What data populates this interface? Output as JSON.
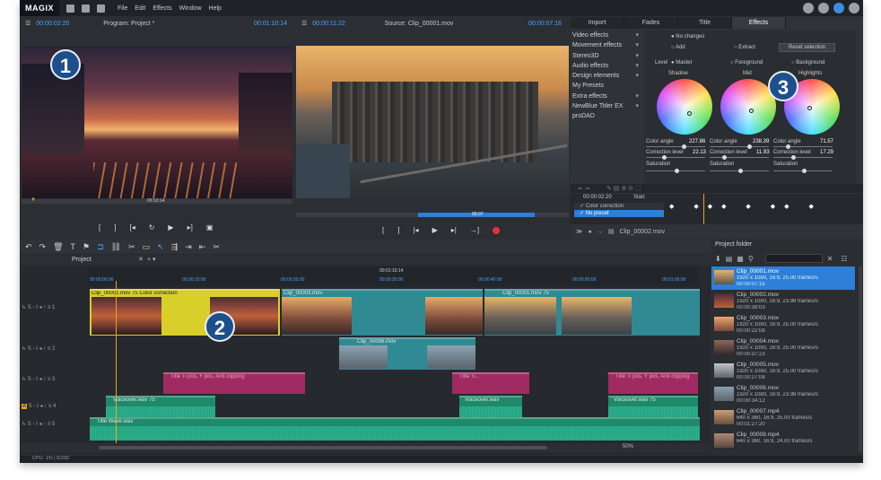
{
  "app": {
    "logo": "MAGIX",
    "menu": [
      "File",
      "Edit",
      "Effects",
      "Window",
      "Help"
    ]
  },
  "program_monitor": {
    "tc_left": "00:00:02:20",
    "title": "Program: Project *",
    "tc_right": "00:01:10:14",
    "scrub_tc": "00:10:14"
  },
  "source_monitor": {
    "tc_left": "00:00:11:22",
    "title": "Source: Clip_00001.mov",
    "tc_right": "00:00:07:16",
    "scrub_tc": "00:07"
  },
  "effects_panel": {
    "tabs": [
      "Import",
      "Fades",
      "Title",
      "Effects"
    ],
    "active_tab": "Effects",
    "categories": [
      "Video effects",
      "Movement effects",
      "Stereo3D",
      "Audio effects",
      "Design elements",
      "My Presets",
      "Extra effects",
      "NewBlue Titler EX",
      "proDAD"
    ],
    "no_changes": "No changes",
    "add": "Add",
    "extract": "Extract",
    "reset": "Reset selection",
    "level_label": "Level",
    "levels": [
      "Master",
      "Foreground",
      "Background"
    ],
    "wheels": [
      {
        "name": "Shadow",
        "color_angle": "227.86",
        "correction_level": "22.13"
      },
      {
        "name": "Mid",
        "color_angle": "238.39",
        "correction_level": "11.93"
      },
      {
        "name": "Highlights",
        "color_angle": "71.57",
        "correction_level": "17.29"
      }
    ],
    "color_angle_label": "Color angle",
    "correction_level_label": "Correction level",
    "saturation_label": "Saturation",
    "kf_time": "00:00:02:20",
    "kf_state": "Stati:",
    "kf_rows": [
      "Color correction",
      "No preset"
    ],
    "clip_name": "Clip_00002.mov"
  },
  "timeline": {
    "tab": "Project",
    "playhead": "00:01:10:14",
    "ruler": [
      "00:00:00:00",
      "00:00:10:00",
      "00:00:20:00",
      "00:00:30:00",
      "00:00:40:00",
      "00:00:50:00",
      "00:01:00:00"
    ],
    "clips": {
      "v1_a": "Clip_00002.mov  75  Color correction",
      "v1_b": "Clip_00003.mov",
      "v1_c": "Clip_00001.mov  75",
      "v2": "Clip_00006.mov",
      "t1": "Title  Ti pos, Y pos, Anti clipping",
      "t2": "Title  Ti...",
      "t3": "Title  Ti pos, Y pos, Anti clipping",
      "a1": "Voiceover.wav  75",
      "a2": "Voiceover.wav",
      "a3": "Voiceover.wav  75",
      "music": "Title Wave.wav"
    },
    "zoom": "50%"
  },
  "project_folder": {
    "title": "Project folder",
    "items": [
      {
        "name": "Clip_00001.mov",
        "info": "1920 x 1080, 16:9, 25.00 frames/s",
        "dur": "00:00:07:15"
      },
      {
        "name": "Clip_00002.mov",
        "info": "1920 x 1080, 16:9, 23.98 frames/s",
        "dur": "00:00:38:03"
      },
      {
        "name": "Clip_00003.mov",
        "info": "1920 x 1080, 16:9, 25.00 frames/s",
        "dur": "00:00:22:08"
      },
      {
        "name": "Clip_00004.mov",
        "info": "1920 x 1080, 16:9, 25.00 frames/s",
        "dur": "00:00:37:23"
      },
      {
        "name": "Clip_00005.mov",
        "info": "1920 x 1080, 16:9, 25.00 frames/s",
        "dur": "00:00:27:08"
      },
      {
        "name": "Clip_00006.mov",
        "info": "1920 x 1080, 16:9, 23.98 frames/s",
        "dur": "00:00:34:12"
      },
      {
        "name": "Clip_00007.mp4",
        "info": "640 x 360, 16:9, 25.00 frames/s",
        "dur": "00:01:27:20"
      },
      {
        "name": "Clip_00008.mp4",
        "info": "640 x 360, 16:9, 24.00 frames/s",
        "dur": ""
      }
    ]
  },
  "status": {
    "cpu": "CPU: 1% | 6/200"
  },
  "badges": [
    "1",
    "2",
    "3"
  ]
}
